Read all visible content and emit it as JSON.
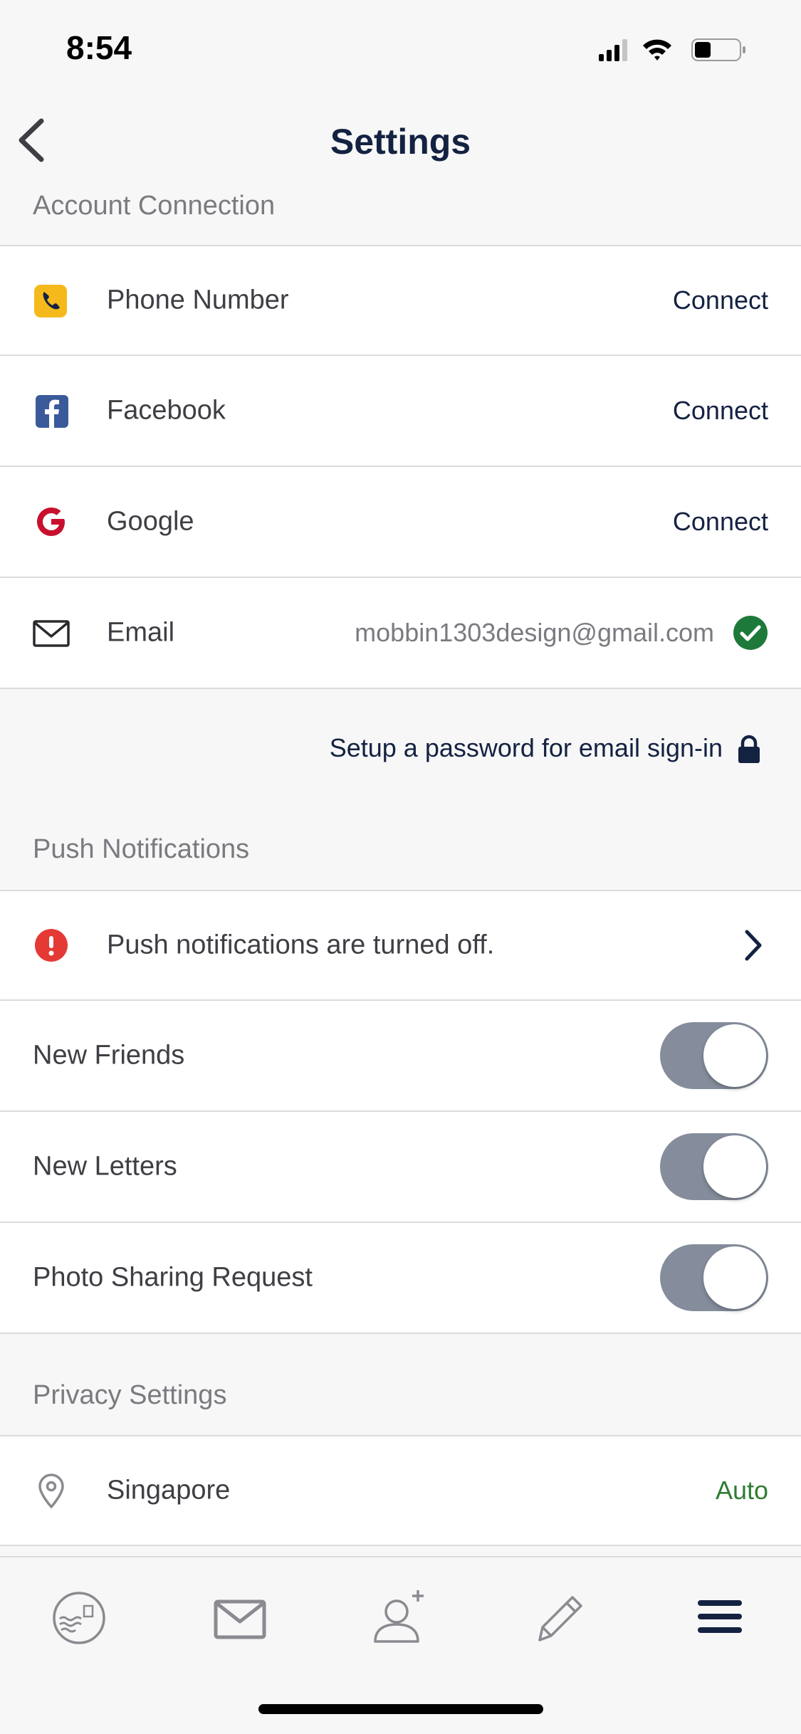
{
  "status_bar": {
    "time": "8:54"
  },
  "nav": {
    "title": "Settings"
  },
  "account_connection": {
    "header": "Account Connection",
    "rows": [
      {
        "label": "Phone Number",
        "action": "Connect"
      },
      {
        "label": "Facebook",
        "action": "Connect"
      },
      {
        "label": "Google",
        "action": "Connect"
      },
      {
        "label": "Email",
        "value": "mobbin1303design@gmail.com"
      }
    ],
    "setup_password": "Setup a password for email sign-in"
  },
  "push_notifications": {
    "header": "Push Notifications",
    "warning": "Push notifications are turned off.",
    "toggles": [
      {
        "label": "New Friends",
        "on": true
      },
      {
        "label": "New Letters",
        "on": true
      },
      {
        "label": "Photo Sharing Request",
        "on": true
      }
    ]
  },
  "privacy_settings": {
    "header": "Privacy Settings",
    "location": {
      "label": "Singapore",
      "value": "Auto"
    }
  },
  "colors": {
    "title": "#142242",
    "phone_icon": "#f5b91c",
    "facebook_icon": "#3b5a9a",
    "google_icon": "#c8102e",
    "success": "#1e7a3a",
    "warning": "#e53935",
    "auto": "#2e7d32",
    "toggle_track": "#858d9c"
  },
  "tab_bar": {
    "tabs": [
      {
        "icon": "stamp-icon"
      },
      {
        "icon": "mail-icon"
      },
      {
        "icon": "add-friend-icon"
      },
      {
        "icon": "pencil-icon"
      },
      {
        "icon": "menu-icon"
      }
    ]
  }
}
